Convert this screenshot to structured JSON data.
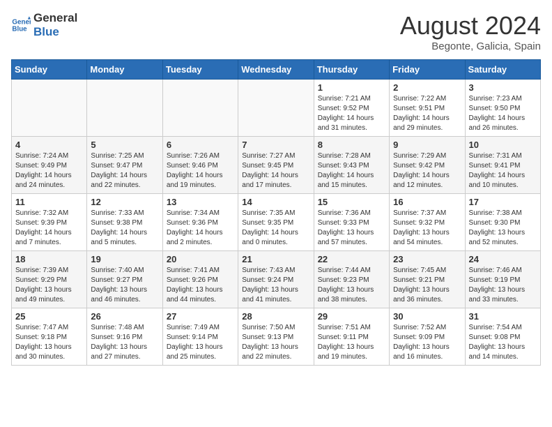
{
  "header": {
    "logo_line1": "General",
    "logo_line2": "Blue",
    "month_year": "August 2024",
    "location": "Begonte, Galicia, Spain"
  },
  "days_of_week": [
    "Sunday",
    "Monday",
    "Tuesday",
    "Wednesday",
    "Thursday",
    "Friday",
    "Saturday"
  ],
  "weeks": [
    [
      {
        "day": "",
        "info": ""
      },
      {
        "day": "",
        "info": ""
      },
      {
        "day": "",
        "info": ""
      },
      {
        "day": "",
        "info": ""
      },
      {
        "day": "1",
        "info": "Sunrise: 7:21 AM\nSunset: 9:52 PM\nDaylight: 14 hours\nand 31 minutes."
      },
      {
        "day": "2",
        "info": "Sunrise: 7:22 AM\nSunset: 9:51 PM\nDaylight: 14 hours\nand 29 minutes."
      },
      {
        "day": "3",
        "info": "Sunrise: 7:23 AM\nSunset: 9:50 PM\nDaylight: 14 hours\nand 26 minutes."
      }
    ],
    [
      {
        "day": "4",
        "info": "Sunrise: 7:24 AM\nSunset: 9:49 PM\nDaylight: 14 hours\nand 24 minutes."
      },
      {
        "day": "5",
        "info": "Sunrise: 7:25 AM\nSunset: 9:47 PM\nDaylight: 14 hours\nand 22 minutes."
      },
      {
        "day": "6",
        "info": "Sunrise: 7:26 AM\nSunset: 9:46 PM\nDaylight: 14 hours\nand 19 minutes."
      },
      {
        "day": "7",
        "info": "Sunrise: 7:27 AM\nSunset: 9:45 PM\nDaylight: 14 hours\nand 17 minutes."
      },
      {
        "day": "8",
        "info": "Sunrise: 7:28 AM\nSunset: 9:43 PM\nDaylight: 14 hours\nand 15 minutes."
      },
      {
        "day": "9",
        "info": "Sunrise: 7:29 AM\nSunset: 9:42 PM\nDaylight: 14 hours\nand 12 minutes."
      },
      {
        "day": "10",
        "info": "Sunrise: 7:31 AM\nSunset: 9:41 PM\nDaylight: 14 hours\nand 10 minutes."
      }
    ],
    [
      {
        "day": "11",
        "info": "Sunrise: 7:32 AM\nSunset: 9:39 PM\nDaylight: 14 hours\nand 7 minutes."
      },
      {
        "day": "12",
        "info": "Sunrise: 7:33 AM\nSunset: 9:38 PM\nDaylight: 14 hours\nand 5 minutes."
      },
      {
        "day": "13",
        "info": "Sunrise: 7:34 AM\nSunset: 9:36 PM\nDaylight: 14 hours\nand 2 minutes."
      },
      {
        "day": "14",
        "info": "Sunrise: 7:35 AM\nSunset: 9:35 PM\nDaylight: 14 hours\nand 0 minutes."
      },
      {
        "day": "15",
        "info": "Sunrise: 7:36 AM\nSunset: 9:33 PM\nDaylight: 13 hours\nand 57 minutes."
      },
      {
        "day": "16",
        "info": "Sunrise: 7:37 AM\nSunset: 9:32 PM\nDaylight: 13 hours\nand 54 minutes."
      },
      {
        "day": "17",
        "info": "Sunrise: 7:38 AM\nSunset: 9:30 PM\nDaylight: 13 hours\nand 52 minutes."
      }
    ],
    [
      {
        "day": "18",
        "info": "Sunrise: 7:39 AM\nSunset: 9:29 PM\nDaylight: 13 hours\nand 49 minutes."
      },
      {
        "day": "19",
        "info": "Sunrise: 7:40 AM\nSunset: 9:27 PM\nDaylight: 13 hours\nand 46 minutes."
      },
      {
        "day": "20",
        "info": "Sunrise: 7:41 AM\nSunset: 9:26 PM\nDaylight: 13 hours\nand 44 minutes."
      },
      {
        "day": "21",
        "info": "Sunrise: 7:43 AM\nSunset: 9:24 PM\nDaylight: 13 hours\nand 41 minutes."
      },
      {
        "day": "22",
        "info": "Sunrise: 7:44 AM\nSunset: 9:23 PM\nDaylight: 13 hours\nand 38 minutes."
      },
      {
        "day": "23",
        "info": "Sunrise: 7:45 AM\nSunset: 9:21 PM\nDaylight: 13 hours\nand 36 minutes."
      },
      {
        "day": "24",
        "info": "Sunrise: 7:46 AM\nSunset: 9:19 PM\nDaylight: 13 hours\nand 33 minutes."
      }
    ],
    [
      {
        "day": "25",
        "info": "Sunrise: 7:47 AM\nSunset: 9:18 PM\nDaylight: 13 hours\nand 30 minutes."
      },
      {
        "day": "26",
        "info": "Sunrise: 7:48 AM\nSunset: 9:16 PM\nDaylight: 13 hours\nand 27 minutes."
      },
      {
        "day": "27",
        "info": "Sunrise: 7:49 AM\nSunset: 9:14 PM\nDaylight: 13 hours\nand 25 minutes."
      },
      {
        "day": "28",
        "info": "Sunrise: 7:50 AM\nSunset: 9:13 PM\nDaylight: 13 hours\nand 22 minutes."
      },
      {
        "day": "29",
        "info": "Sunrise: 7:51 AM\nSunset: 9:11 PM\nDaylight: 13 hours\nand 19 minutes."
      },
      {
        "day": "30",
        "info": "Sunrise: 7:52 AM\nSunset: 9:09 PM\nDaylight: 13 hours\nand 16 minutes."
      },
      {
        "day": "31",
        "info": "Sunrise: 7:54 AM\nSunset: 9:08 PM\nDaylight: 13 hours\nand 14 minutes."
      }
    ]
  ]
}
